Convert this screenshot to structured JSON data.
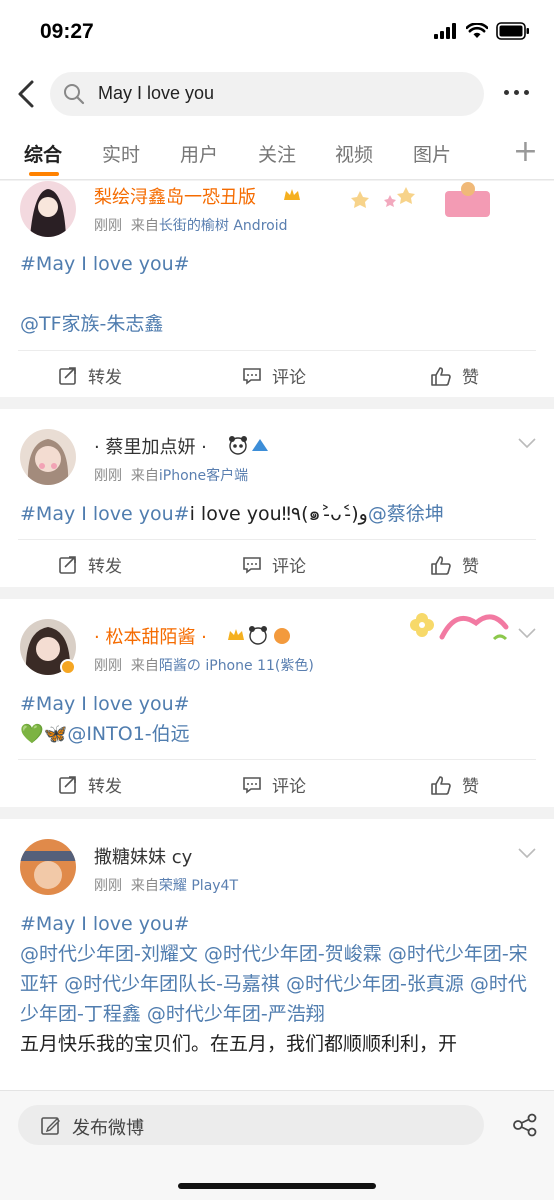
{
  "status_bar": {
    "time": "09:27"
  },
  "search": {
    "query": "May I love you"
  },
  "tabs": [
    {
      "label": "综合"
    },
    {
      "label": "实时"
    },
    {
      "label": "用户"
    },
    {
      "label": "关注"
    },
    {
      "label": "视频"
    },
    {
      "label": "图片"
    }
  ],
  "actions": {
    "repost": "转发",
    "comment": "评论",
    "like": "赞"
  },
  "posts": [
    {
      "username": "梨绘浔鑫岛一恐丑版",
      "time": "刚刚",
      "source_prefix": "来自",
      "source": "长街的榆树 Android",
      "hashtag": "#May I love you#",
      "mention": "@TF家族-朱志鑫"
    },
    {
      "username": "· 蔡里加点妍 ·",
      "time": "刚刚",
      "source_prefix": "来自",
      "source": "iPhone客户端",
      "hashtag": "#May I love you#",
      "text": "i love you‼٩(๑˃̵ᴗ˂̵)و",
      "mention": "@蔡徐坤"
    },
    {
      "username": "· 松本甜陌酱 ·",
      "time": "刚刚",
      "source_prefix": "来自",
      "source": "陌酱の iPhone 11(紫色)",
      "hashtag": "#May I love you#",
      "emoji": "💚🦋",
      "mention": "@INTO1-伯远"
    },
    {
      "username": "撒糖妹妹 cy",
      "time": "刚刚",
      "source_prefix": "来自",
      "source": "荣耀 Play4T",
      "hashtag": "#May I love you#",
      "mentions": [
        "@时代少年团-刘耀文",
        "@时代少年团-贺峻霖",
        "@时代少年团-宋亚轩",
        "@时代少年团队长-马嘉祺",
        "@时代少年团-张真源",
        "@时代少年团-丁程鑫",
        "@时代少年团-严浩翔"
      ],
      "text": "五月快乐我的宝贝们。在五月，我们都顺顺利利，开"
    }
  ],
  "bottom": {
    "compose_label": "发布微博"
  },
  "colors": {
    "accent": "#ff8200",
    "link": "#507daf",
    "vip_name": "#f56b00"
  }
}
